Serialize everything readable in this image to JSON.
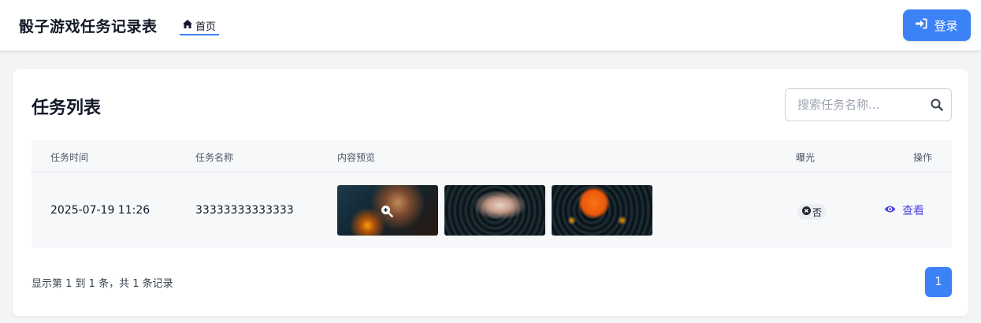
{
  "header": {
    "app_title": "骰子游戏任务记录表",
    "nav_home_label": "首页",
    "login_label": "登录"
  },
  "card": {
    "title": "任务列表",
    "search": {
      "placeholder": "搜索任务名称...",
      "value": ""
    }
  },
  "table": {
    "columns": [
      "任务时间",
      "任务名称",
      "内容预览",
      "曝光",
      "操作"
    ],
    "rows": [
      {
        "time": "2025-07-19 11:26",
        "name": "33333333333333",
        "exposure": "否",
        "action_label": "查看"
      }
    ]
  },
  "pagination": {
    "summary": "显示第 1 到 1 条，共 1 条记录",
    "current_page": "1"
  },
  "icons": {
    "home": "home-icon",
    "login": "sign-in-icon",
    "search": "search-icon",
    "zoom": "zoom-in-icon",
    "exposure": "x-circle-icon",
    "view": "eye-icon"
  },
  "colors": {
    "accent": "#3b82f6",
    "view_link": "#4f46e5",
    "background": "#f3f4f6"
  }
}
